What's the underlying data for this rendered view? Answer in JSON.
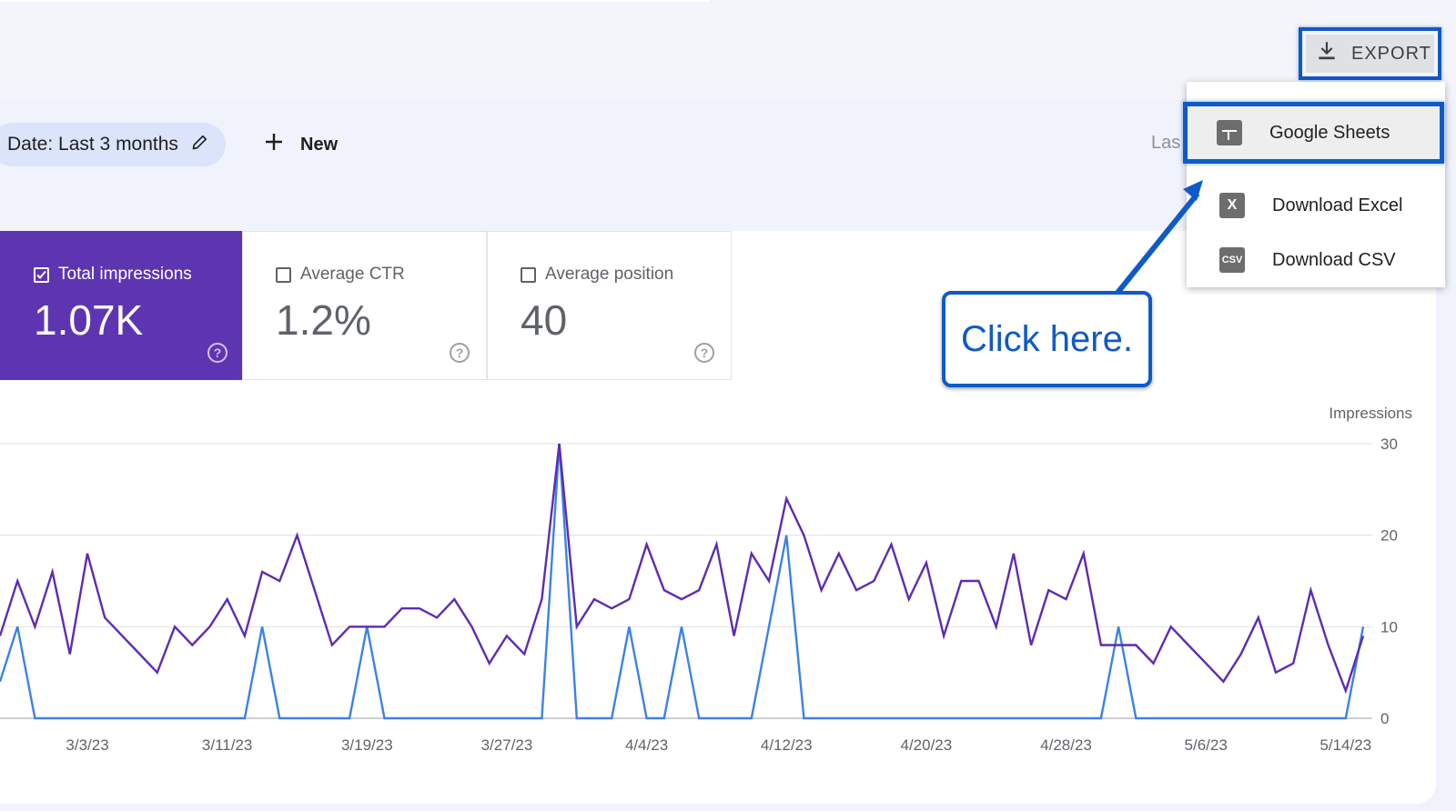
{
  "toolbar": {
    "export_label": "EXPORT"
  },
  "export_menu": {
    "items": [
      {
        "label": "Google Sheets",
        "icon": "google-sheets-icon"
      },
      {
        "label": "Download Excel",
        "icon": "excel-icon",
        "glyph": "X"
      },
      {
        "label": "Download CSV",
        "icon": "csv-icon",
        "glyph": "CSV"
      }
    ]
  },
  "filters": {
    "date_chip": "Date: Last 3 months",
    "new_label": "New",
    "right_partial": "Las"
  },
  "metrics": [
    {
      "label": "Total impressions",
      "value": "1.07K",
      "checked": true
    },
    {
      "label": "Average CTR",
      "value": "1.2%",
      "checked": false
    },
    {
      "label": "Average position",
      "value": "40",
      "checked": false
    }
  ],
  "callout": {
    "text": "Click here."
  },
  "colors": {
    "purple": "#5e35b1",
    "line_purple": "#5e2bb4",
    "line_blue": "#3b82e6",
    "annotation_blue": "#0f5ac9"
  },
  "chart_data": {
    "type": "line",
    "ylabel": "Impressions",
    "ylim": [
      0,
      30
    ],
    "yticks": [
      0,
      10,
      20,
      30
    ],
    "x_tick_labels": [
      "3/3/23",
      "3/11/23",
      "3/19/23",
      "3/27/23",
      "4/4/23",
      "4/12/23",
      "4/20/23",
      "4/28/23",
      "5/6/23",
      "5/14/23"
    ],
    "x_tick_indices": [
      5,
      13,
      21,
      29,
      37,
      45,
      53,
      61,
      69,
      77
    ],
    "grid": true,
    "series": [
      {
        "color": "#5e2bb4",
        "values": [
          9,
          15,
          10,
          16,
          7,
          18,
          11,
          9,
          7,
          5,
          10,
          8,
          10,
          13,
          9,
          16,
          15,
          20,
          14,
          8,
          10,
          10,
          10,
          12,
          12,
          11,
          13,
          10,
          6,
          9,
          7,
          13,
          30,
          10,
          13,
          12,
          13,
          19,
          14,
          13,
          14,
          19,
          9,
          18,
          15,
          24,
          20,
          14,
          18,
          14,
          15,
          19,
          13,
          17,
          9,
          15,
          15,
          10,
          18,
          8,
          14,
          13,
          18,
          8,
          8,
          8,
          6,
          10,
          8,
          6,
          4,
          7,
          11,
          5,
          6,
          14,
          8,
          3,
          9
        ]
      },
      {
        "color": "#3b82e6",
        "values": [
          4,
          10,
          0,
          0,
          0,
          0,
          0,
          0,
          0,
          0,
          0,
          0,
          0,
          0,
          0,
          10,
          0,
          0,
          0,
          0,
          0,
          10,
          0,
          0,
          0,
          0,
          0,
          0,
          0,
          0,
          0,
          0,
          30,
          0,
          0,
          0,
          10,
          0,
          0,
          10,
          0,
          0,
          0,
          0,
          10,
          20,
          0,
          0,
          0,
          0,
          0,
          0,
          0,
          0,
          0,
          0,
          0,
          0,
          0,
          0,
          0,
          0,
          0,
          0,
          10,
          0,
          0,
          0,
          0,
          0,
          0,
          0,
          0,
          0,
          0,
          0,
          0,
          0,
          10
        ]
      }
    ]
  }
}
